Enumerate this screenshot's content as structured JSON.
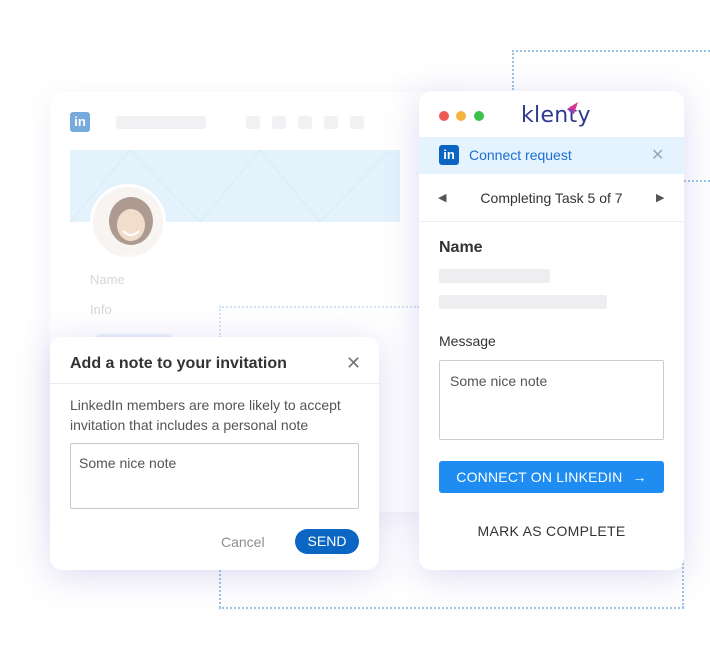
{
  "colors": {
    "linkedin_blue": "#0a66c2",
    "klenty_navy": "#2f3a8f",
    "klenty_accent": "#e0338d",
    "connect_button": "#1e8cf0",
    "connect_bar_bg": "#e4f3fd"
  },
  "background_profile": {
    "logo_icon": "linkedin-icon",
    "name_label": "Name",
    "info_label": "Info"
  },
  "panel": {
    "brand": "klenty",
    "connect_request": {
      "icon": "linkedin-icon",
      "label": "Connect request",
      "close_icon": "close-icon"
    },
    "task": {
      "prev_icon": "triangle-left-icon",
      "label": "Completing Task 5 of 7",
      "next_icon": "triangle-right-icon"
    },
    "name_title": "Name",
    "message_label": "Message",
    "message_value": "Some nice note",
    "connect_button": "CONNECT ON LINKEDIN",
    "connect_button_icon": "arrow-right-icon",
    "mark_complete_button": "MARK AS COMPLETE"
  },
  "dialog": {
    "title": "Add a note to your invitation",
    "close_icon": "close-icon",
    "description": "LinkedIn members are more likely to accept invitation that includes a personal note",
    "note_value": "Some nice note",
    "cancel_button": "Cancel",
    "send_button": "SEND"
  }
}
